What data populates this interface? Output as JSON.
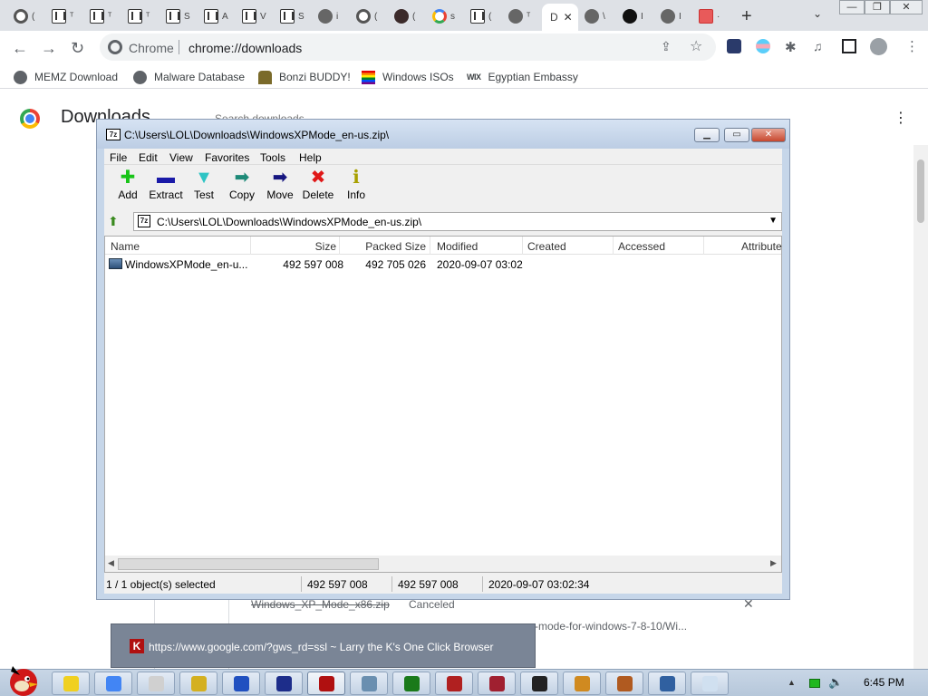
{
  "browser": {
    "tabs": [
      {
        "icon": "chrome-icon",
        "label": "("
      },
      {
        "icon": "strip-icon",
        "label": "ᵀ"
      },
      {
        "icon": "strip-icon",
        "label": "ᵀ"
      },
      {
        "icon": "strip-icon",
        "label": "ᵀ"
      },
      {
        "icon": "strip-icon",
        "label": "S"
      },
      {
        "icon": "strip-icon",
        "label": "A"
      },
      {
        "icon": "strip-icon",
        "label": "V"
      },
      {
        "icon": "strip-icon",
        "label": "S"
      },
      {
        "icon": "globe-icon",
        "label": "i"
      },
      {
        "icon": "chrome-icon",
        "label": "("
      },
      {
        "icon": "cat-icon",
        "label": "("
      },
      {
        "icon": "google-icon",
        "label": "s"
      },
      {
        "icon": "strip-icon",
        "label": "("
      },
      {
        "icon": "globe-icon",
        "label": "ᵀ"
      },
      {
        "icon": "globe-icon",
        "label": "\\"
      },
      {
        "icon": "github-icon",
        "label": "I"
      },
      {
        "icon": "globe-icon",
        "label": "I"
      },
      {
        "icon": "red-icon",
        "label": "·"
      }
    ],
    "active_tab": {
      "label": "D",
      "close": "✕"
    },
    "new_tab": "+",
    "tab_search": "⌄",
    "window_controls": {
      "minimize": "—",
      "maximize": "❐",
      "close": "✕"
    },
    "site_name": "Chrome",
    "url": "chrome://downloads",
    "bookmarks": [
      {
        "label": "MEMZ Download",
        "icon": "globe-icon"
      },
      {
        "label": "Malware Database",
        "icon": "globe-icon"
      },
      {
        "label": "Bonzi BUDDY!",
        "icon": "bonzi-icon"
      },
      {
        "label": "Windows ISOs",
        "icon": "rainbow-flag-icon"
      },
      {
        "label": "Egyptian Embassy",
        "icon": "wix-icon",
        "badge": "WIX"
      }
    ]
  },
  "downloads_page": {
    "title": "Downloads",
    "search_placeholder": "Search downloads",
    "menu_glyph": "⋮",
    "entry": {
      "filename": "Windows_XP_Mode_x86.zip",
      "status": "Canceled",
      "close": "✕",
      "url_fragment": "-mode-for-windows-7-8-10/Wi..."
    }
  },
  "zip": {
    "title": "C:\\Users\\LOL\\Downloads\\WindowsXPMode_en-us.zip\\",
    "icon_text": "7z",
    "menus": [
      "File",
      "Edit",
      "View",
      "Favorites",
      "Tools",
      "Help"
    ],
    "tools": [
      {
        "label": "Add",
        "glyph": "✚",
        "color": "#18c418"
      },
      {
        "label": "Extract",
        "glyph": "▬",
        "color": "#1a1aa8"
      },
      {
        "label": "Test",
        "glyph": "▼",
        "color": "#2ec4c4"
      },
      {
        "label": "Copy",
        "glyph": "➡",
        "color": "#1e8a78"
      },
      {
        "label": "Move",
        "glyph": "➡",
        "color": "#161680"
      },
      {
        "label": "Delete",
        "glyph": "✖",
        "color": "#e01818"
      },
      {
        "label": "Info",
        "glyph": "ℹ",
        "color": "#a8a000"
      }
    ],
    "address": "C:\\Users\\LOL\\Downloads\\WindowsXPMode_en-us.zip\\",
    "columns": [
      "Name",
      "Size",
      "Packed Size",
      "Modified",
      "Created",
      "Accessed",
      "Attribute"
    ],
    "rows": [
      {
        "name": "WindowsXPMode_en-u...",
        "size": "492 597 008",
        "packed": "492 705 026",
        "modified": "2020-09-07 03:02"
      }
    ],
    "status": {
      "selected": "1 / 1 object(s) selected",
      "size": "492 597 008",
      "packed": "492 597 008",
      "modified": "2020-09-07 03:02:34"
    },
    "scroll_left": "◀",
    "scroll_right": "▶"
  },
  "popup": {
    "icon_text": "K",
    "text": "https://www.google.com/?gws_rd=ssl ~ Larry the K's One Click Browser"
  },
  "taskbar": {
    "clock": "6:45 PM",
    "tray_up": "▲",
    "volume_glyph": "🔈",
    "apps": [
      {
        "name": "taskbar-app-notes",
        "color": "#f0d020"
      },
      {
        "name": "taskbar-app-chrome",
        "color": "#4285f4"
      },
      {
        "name": "taskbar-app-card",
        "color": "#d0d0d0"
      },
      {
        "name": "taskbar-app-coin",
        "color": "#d4b020"
      },
      {
        "name": "taskbar-app-help",
        "color": "#2050c0"
      },
      {
        "name": "taskbar-app-font",
        "color": "#1d2d8a"
      },
      {
        "name": "taskbar-app-larry-browser",
        "color": "#b01010"
      },
      {
        "name": "taskbar-app-monkey",
        "color": "#6a8fb0"
      },
      {
        "name": "taskbar-app-tree",
        "color": "#1a7a1a"
      },
      {
        "name": "taskbar-app-spider",
        "color": "#b02020"
      },
      {
        "name": "taskbar-app-badge",
        "color": "#a02030"
      },
      {
        "name": "taskbar-app-7zip",
        "color": "#222222"
      },
      {
        "name": "taskbar-app-bottle",
        "color": "#d08a20"
      },
      {
        "name": "taskbar-app-tools",
        "color": "#b05a20"
      },
      {
        "name": "taskbar-app-rocket",
        "color": "#3060a0"
      },
      {
        "name": "taskbar-app-notepad",
        "color": "#d0e0f0"
      }
    ]
  }
}
